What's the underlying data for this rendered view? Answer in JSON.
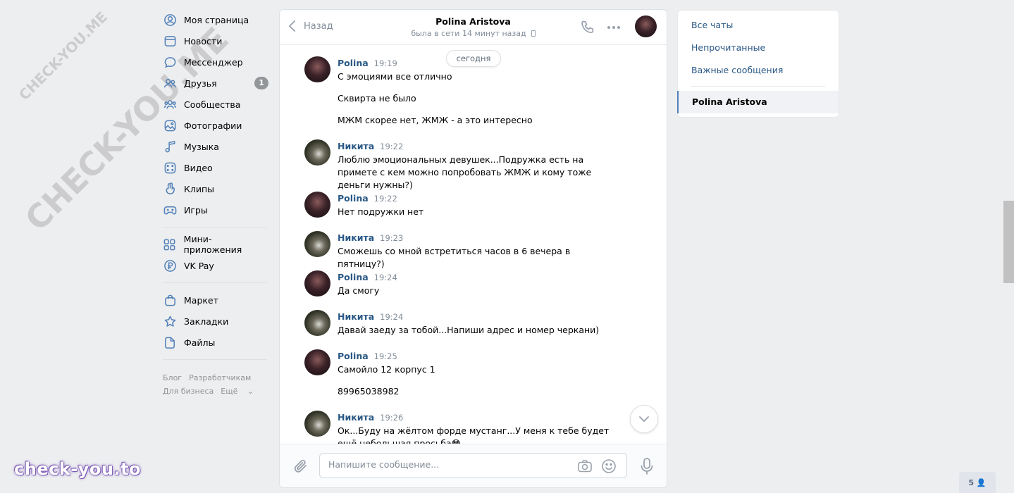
{
  "nav": {
    "items": [
      {
        "label": "Моя страница",
        "icon": "user-circle-icon"
      },
      {
        "label": "Новости",
        "icon": "newspaper-icon"
      },
      {
        "label": "Мессенджер",
        "icon": "message-bubble-icon"
      },
      {
        "label": "Друзья",
        "icon": "friends-icon",
        "badge": "1"
      },
      {
        "label": "Сообщества",
        "icon": "communities-icon"
      },
      {
        "label": "Фотографии",
        "icon": "photo-icon"
      },
      {
        "label": "Музыка",
        "icon": "music-note-icon"
      },
      {
        "label": "Видео",
        "icon": "video-icon"
      },
      {
        "label": "Клипы",
        "icon": "clips-icon"
      },
      {
        "label": "Игры",
        "icon": "gamepad-icon"
      }
    ],
    "items2": [
      {
        "label": "Мини-приложения",
        "icon": "apps-grid-icon"
      },
      {
        "label": "VK Pay",
        "icon": "ruble-coin-icon"
      }
    ],
    "items3": [
      {
        "label": "Маркет",
        "icon": "shopping-bag-icon"
      },
      {
        "label": "Закладки",
        "icon": "star-icon"
      },
      {
        "label": "Файлы",
        "icon": "file-icon"
      }
    ],
    "footer": [
      "Блог",
      "Разработчикам",
      "Для бизнеса",
      "Ещё"
    ]
  },
  "chat": {
    "back_label": "Назад",
    "peer_name": "Polina Aristova",
    "peer_status": "была в сети 14 минут назад",
    "date_divider": "сегодня",
    "messages": [
      {
        "author": "Polina",
        "time": "19:19",
        "avatar": "polina",
        "lines": [
          "С эмоциями все отлично",
          "Сквирта не было",
          "МЖМ скорее нет, ЖМЖ - а это интересно"
        ]
      },
      {
        "author": "Никита",
        "time": "19:22",
        "avatar": "nikita",
        "lines": [
          "Люблю эмоциональных девушек...Подружка есть на примете с кем можно попробовать ЖМЖ и кому тоже деньги нужны?)"
        ]
      },
      {
        "author": "Polina",
        "time": "19:22",
        "avatar": "polina",
        "lines": [
          "Нет подружки нет"
        ]
      },
      {
        "author": "Никита",
        "time": "19:23",
        "avatar": "nikita",
        "lines": [
          "Сможешь со мной встретиться часов в 6 вечера в пятницу?)"
        ]
      },
      {
        "author": "Polina",
        "time": "19:24",
        "avatar": "polina",
        "lines": [
          "Да смогу"
        ]
      },
      {
        "author": "Никита",
        "time": "19:24",
        "avatar": "nikita",
        "lines": [
          "Давай заеду за тобой...Напиши адрес и номер черкани)"
        ]
      },
      {
        "author": "Polina",
        "time": "19:25",
        "avatar": "polina",
        "lines": [
          "Самойло 12 корпус 1",
          "89965038982"
        ]
      },
      {
        "author": "Никита",
        "time": "19:26",
        "avatar": "nikita",
        "lines": [
          "Ок...Буду на жёлтом форде мустанг...У меня к тебе будет ещё небольшая просьба😳"
        ]
      }
    ],
    "composer_placeholder": "Напишите сообщение..."
  },
  "right_panel": {
    "filters": [
      "Все чаты",
      "Непрочитанные",
      "Важные сообщения"
    ],
    "active_chat": "Polina Aristova"
  },
  "watermarks": [
    "CHECK-YOU.ME",
    "CHECK-YOU.ME"
  ],
  "brand_logo": "check-you.to",
  "online_count": "5",
  "colors": {
    "accent": "#2a5885",
    "background": "#edeef0",
    "icon": "#5181b8"
  }
}
